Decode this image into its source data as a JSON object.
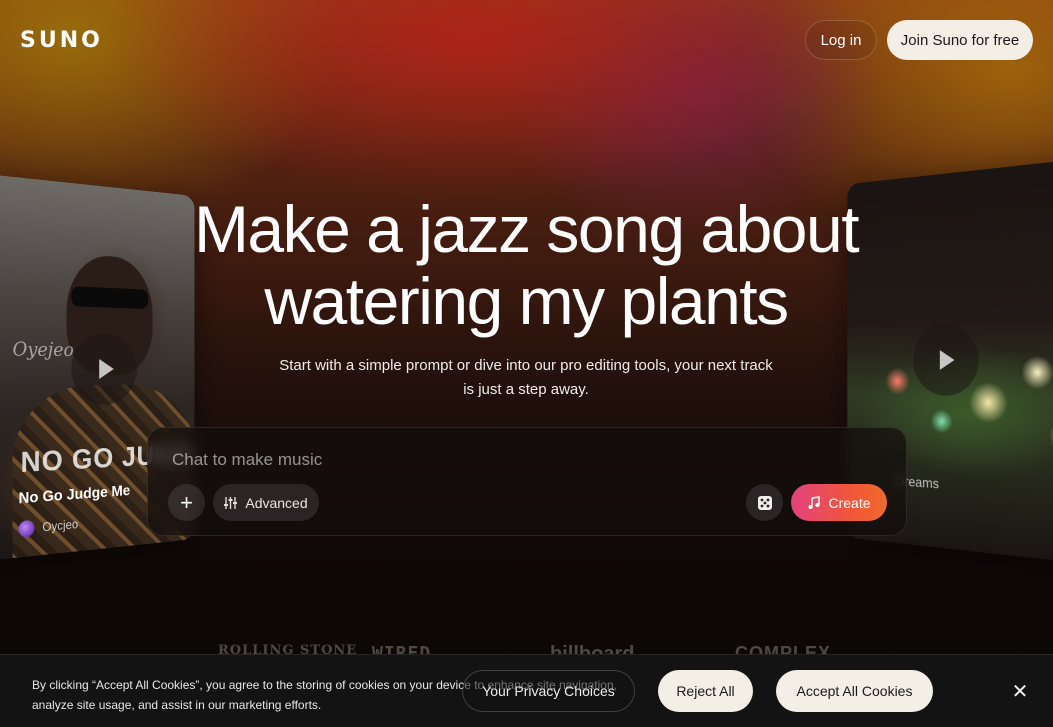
{
  "header": {
    "logo_text": "SUNO",
    "login_label": "Log in",
    "join_label": "Join Suno for free"
  },
  "hero": {
    "title_line1": "Make a jazz song about",
    "title_line2": "watering my plants",
    "subtitle": "Start with a simple prompt or dive into our pro editing tools, your next track is just a step away."
  },
  "left_card": {
    "script_text": "Oyejeo",
    "overlay_title": "NO GO JUDGE ME",
    "song_title": "No Go Judge Me",
    "artist": "Oycjeo"
  },
  "right_card": {
    "label": "Dreams"
  },
  "composer": {
    "placeholder": "Chat to make music",
    "plus_label": "+",
    "advanced_label": "Advanced",
    "create_label": "Create"
  },
  "press": [
    "ROLLING STONE",
    "WIRED",
    "billboard",
    "COMPLEX"
  ],
  "cookie_banner": {
    "text": "By clicking “Accept All Cookies”, you agree to the storing of cookies on your device to enhance site navigation, analyze site usage, and assist in our marketing efforts.",
    "privacy_label": "Your Privacy Choices",
    "reject_label": "Reject All",
    "accept_label": "Accept All Cookies",
    "close_label": "✕"
  },
  "colors": {
    "accent_gradient_start": "#e2427e",
    "accent_gradient_end": "#f06a2a",
    "light_button": "#f3eee6"
  }
}
